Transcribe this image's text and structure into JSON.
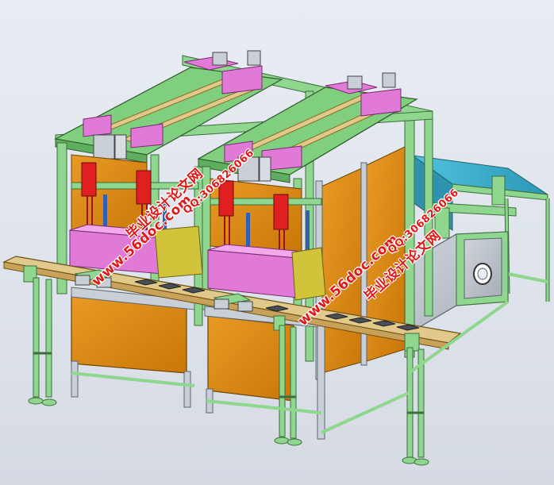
{
  "watermarks": {
    "site_1": "www.56doc.com",
    "qq_1": "QQ:306826066",
    "title_1": "毕业设计论文网",
    "site_2": "www.56doc.com",
    "qq_2": "QQ:306826066",
    "title_2": "毕业设计论文网"
  },
  "colors": {
    "frame_green": "#8fd68f",
    "frame_edge": "#3d6e3d",
    "plate_pink": "#e07ad6",
    "cylinder_red": "#e02020",
    "panel_orange": "#d9860f",
    "belt_cyan": "#3fb2cf",
    "rail_tan": "#c9a25a",
    "die_yellow": "#d2c43a",
    "die_blue": "#2f5fb7",
    "cabinet_gray": "#b9bfc8",
    "watermark_red": "#e01818"
  }
}
